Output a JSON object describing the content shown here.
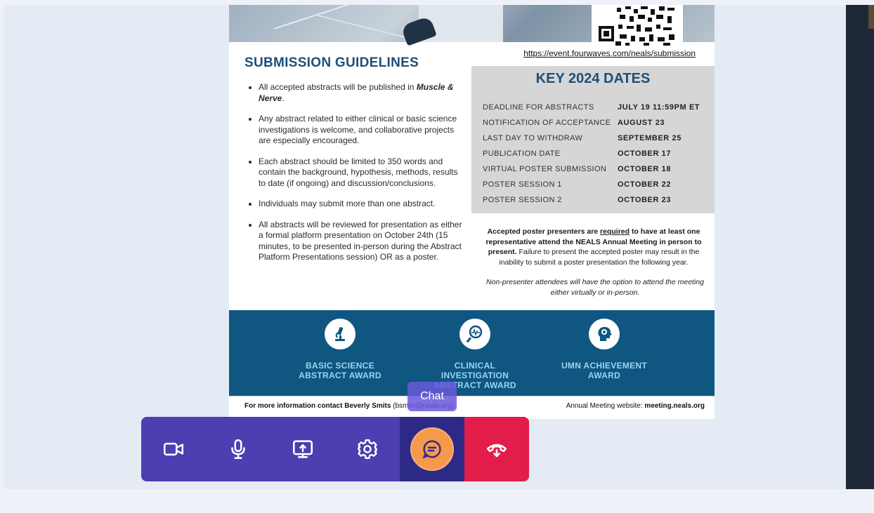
{
  "poster": {
    "url": "https://event.fourwaves.com/neals/submission",
    "guidelines_title": "SUBMISSION GUIDELINES",
    "guidelines": [
      {
        "text": "All accepted abstracts will be published in ",
        "em": "Muscle & Nerve",
        "tail": "."
      },
      {
        "text": "Any abstract related to either clinical or basic science investigations is welcome, and collaborative projects are especially encouraged.",
        "em": "",
        "tail": ""
      },
      {
        "text": "Each abstract should be limited to 350 words and contain the background, hypothesis, methods, results to date (if ongoing) and discussion/conclusions.",
        "em": "",
        "tail": ""
      },
      {
        "text": "Individuals may submit more than one abstract.",
        "em": "",
        "tail": ""
      },
      {
        "text": "All abstracts will be reviewed for presentation as either a formal platform presentation on October 24th (15 minutes, to be presented in-person during the Abstract Platform Presentations session) OR as a poster.",
        "em": "",
        "tail": ""
      }
    ],
    "dates_title": "KEY 2024 DATES",
    "dates": [
      {
        "label": "DEADLINE FOR ABSTRACTS",
        "value": "JULY 19 11:59PM ET"
      },
      {
        "label": "NOTIFICATION OF ACCEPTANCE",
        "value": "AUGUST 23"
      },
      {
        "label": "LAST DAY TO WITHDRAW",
        "value": "SEPTEMBER 25"
      },
      {
        "label": "PUBLICATION DATE",
        "value": "OCTOBER 17"
      },
      {
        "label": "VIRTUAL POSTER SUBMISSION",
        "value": "OCTOBER 18"
      },
      {
        "label": "POSTER SESSION 1",
        "value": "OCTOBER 22"
      },
      {
        "label": "POSTER SESSION 2",
        "value": "OCTOBER 23"
      }
    ],
    "notice": {
      "a": "Accepted poster presenters are ",
      "b": "required",
      "c": " to have at least one representative attend the NEALS Annual Meeting in person to present.",
      "d": " Failure to present the accepted poster may result in the inability to submit a poster presentation the following year."
    },
    "italic_note": "Non-presenter attendees will have the option to attend the meeting either virtually or in-person.",
    "awards": [
      {
        "label": "BASIC SCIENCE\nABSTRACT AWARD",
        "icon": "microscope-icon"
      },
      {
        "label": "CLINICAL\nINVESTIGATION\nABSTRACT AWARD",
        "icon": "magnifier-icon"
      },
      {
        "label": "UMN ACHIEVEMENT\nAWARD",
        "icon": "brain-head-icon"
      }
    ],
    "footer_left_bold": "For more information contact Beverly Smits",
    "footer_left_rest": " (bsmits@neals.org)",
    "footer_right_text": "Annual Meeting website: ",
    "footer_right_bold": "meeting.neals.org"
  },
  "tooltip": {
    "chat": "Chat"
  },
  "toolbar": {
    "buttons": [
      {
        "name": "camera",
        "icon": "video-camera-icon"
      },
      {
        "name": "microphone",
        "icon": "microphone-icon"
      },
      {
        "name": "share-screen",
        "icon": "screen-share-icon"
      },
      {
        "name": "settings",
        "icon": "gear-icon"
      },
      {
        "name": "chat",
        "icon": "chat-bubble-icon"
      },
      {
        "name": "leave",
        "icon": "hang-up-icon"
      }
    ],
    "colors": {
      "bar": "#4b3fb2",
      "active": "#2c2a86",
      "end": "#e21d4a",
      "highlight": "#f59a4a"
    }
  }
}
